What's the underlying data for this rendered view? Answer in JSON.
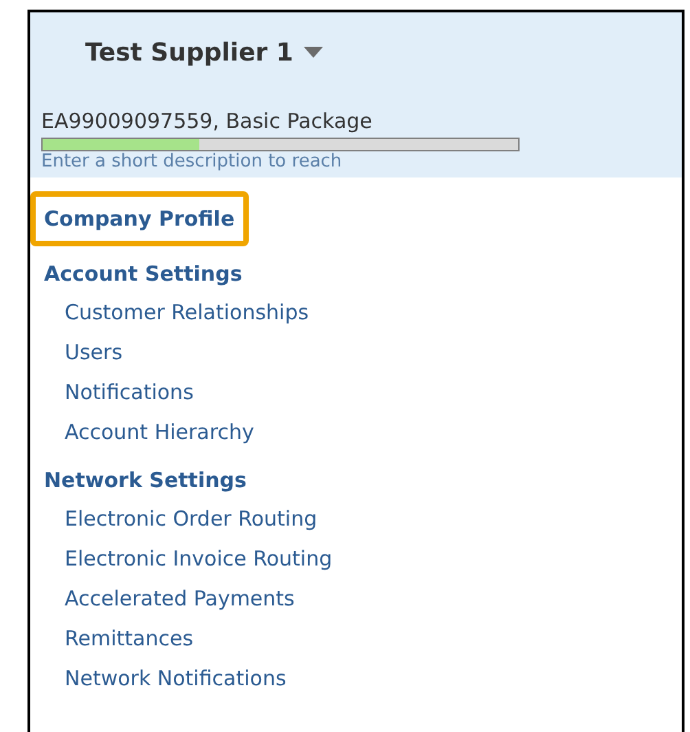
{
  "header": {
    "supplier": "Test Supplier 1",
    "package": "EA99009097559, Basic Package",
    "progress": {
      "level": 0.33
    },
    "hint_link": "Enter a short description to reach"
  },
  "nav": [
    {
      "kind": "link",
      "label": "Company Profile",
      "highlighted": true
    },
    {
      "kind": "section",
      "label": "Account Settings",
      "highlighted": false,
      "children": [
        {
          "label": "Customer Relationships"
        },
        {
          "label": "Users"
        },
        {
          "label": "Notifications"
        },
        {
          "label": "Account Hierarchy"
        }
      ]
    },
    {
      "kind": "section",
      "label": "Network Settings",
      "highlighted": false,
      "children": [
        {
          "label": "Electronic Order Routing"
        },
        {
          "label": "Electronic Invoice Routing"
        },
        {
          "label": "Accelerated Payments"
        },
        {
          "label": "Remittances"
        },
        {
          "label": "Network Notifications"
        }
      ]
    }
  ]
}
